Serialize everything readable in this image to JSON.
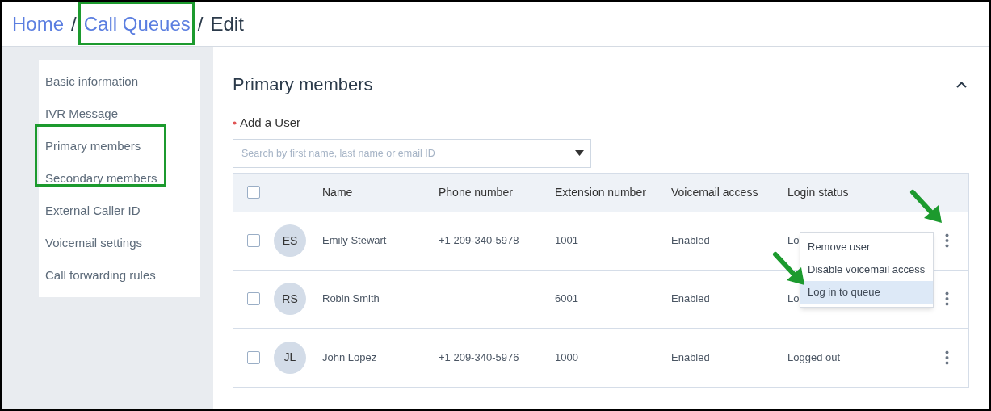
{
  "breadcrumb": [
    {
      "label": "Home",
      "current": false
    },
    {
      "separator": "/",
      "label": "Call Queues",
      "current": false
    },
    {
      "separator": "/",
      "label": "Edit",
      "current": true
    }
  ],
  "sidebar": {
    "items": [
      {
        "label": "Basic information"
      },
      {
        "label": "IVR Message"
      },
      {
        "label": "Primary members"
      },
      {
        "label": "Secondary members"
      },
      {
        "label": "External Caller ID"
      },
      {
        "label": "Voicemail settings"
      },
      {
        "label": "Call forwarding rules"
      }
    ]
  },
  "section": {
    "title": "Primary members",
    "expanded": true
  },
  "add_user": {
    "label": "Add a User",
    "required": true,
    "placeholder": "Search by first name, last name or email ID"
  },
  "table": {
    "columns": [
      "Name",
      "Phone number",
      "Extension number",
      "Voicemail access",
      "Login status"
    ],
    "header_checked": false,
    "rows": [
      {
        "initials": "ES",
        "name": "Emily Stewart",
        "phone": "+1 209-340-5978",
        "extension": "1001",
        "voicemail": "Enabled",
        "login_status": "Lo",
        "checked": false
      },
      {
        "initials": "RS",
        "name": "Robin Smith",
        "extension": "6001",
        "voicemail": "Enabled",
        "login_status": "Lo",
        "checked": false
      },
      {
        "initials": "JL",
        "name": "John Lopez",
        "phone": "+1 209-340-5976",
        "extension": "1000",
        "voicemail": "Enabled",
        "login_status": "Logged out",
        "checked": false
      }
    ]
  },
  "row_menu": {
    "items": [
      {
        "label": "Remove user",
        "selected": false
      },
      {
        "label": "Disable voicemail access",
        "selected": false
      },
      {
        "label": "Log in to queue",
        "selected": true
      }
    ]
  }
}
